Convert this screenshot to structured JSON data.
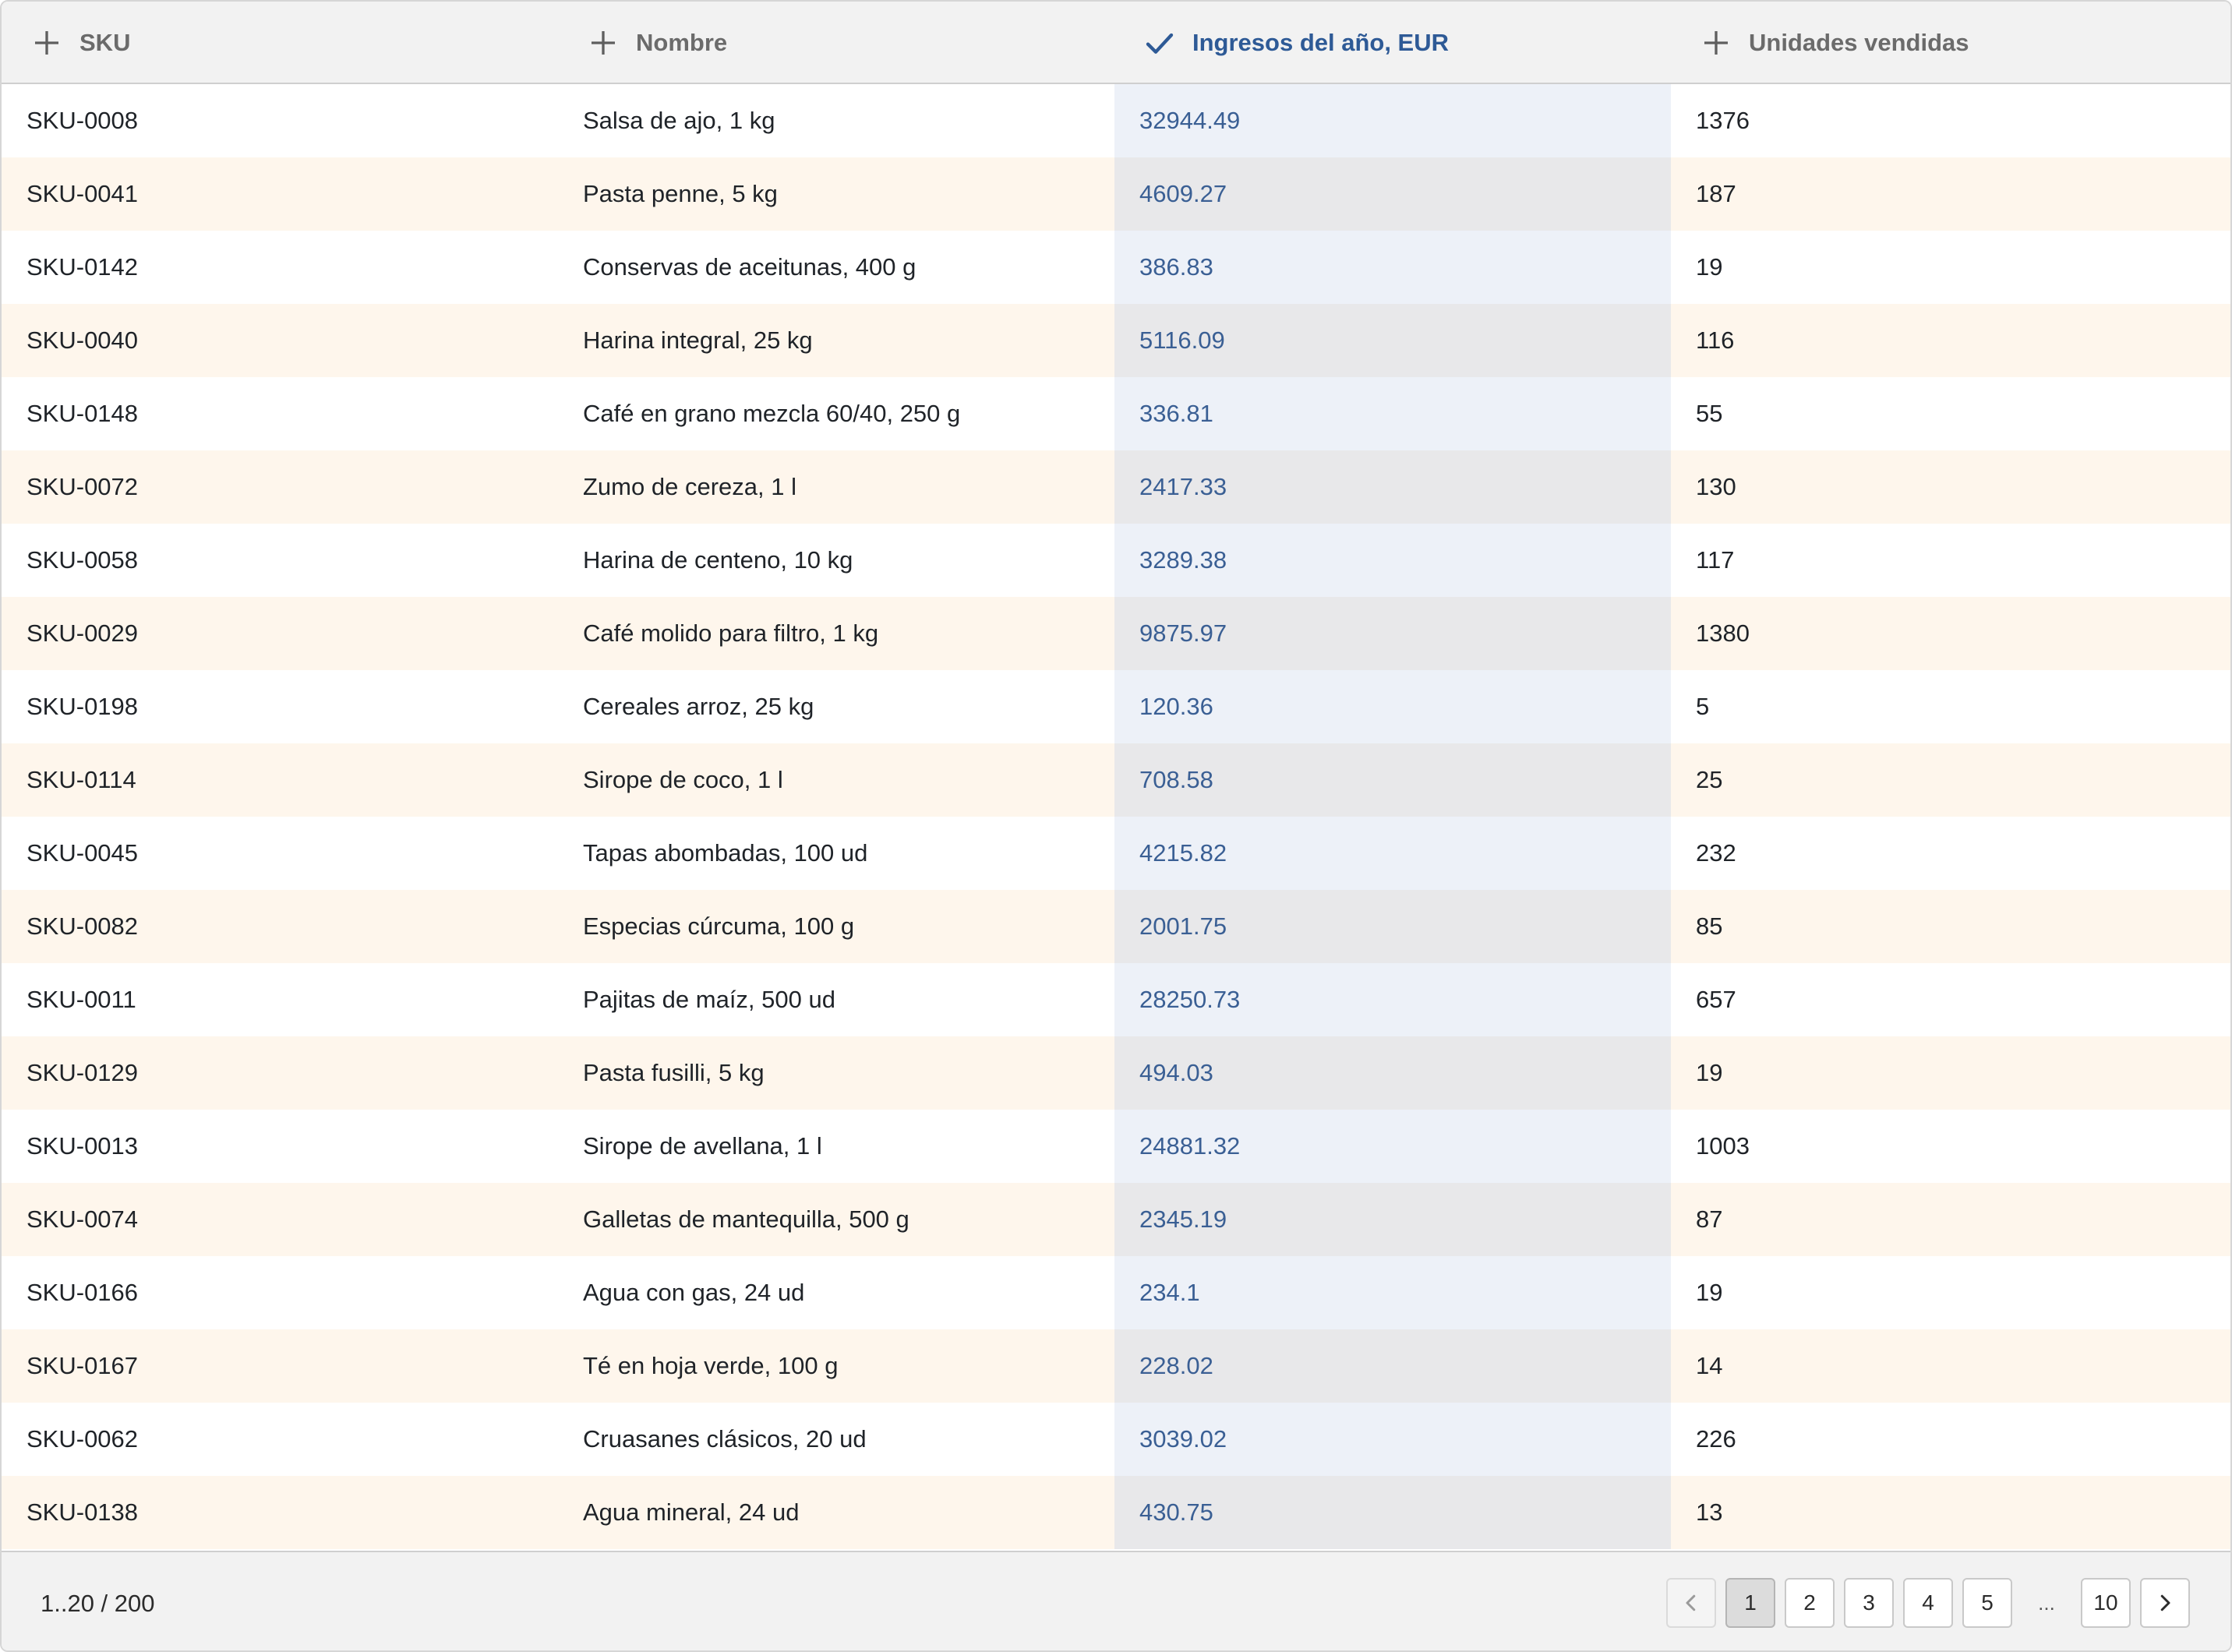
{
  "columns": [
    {
      "label": "SKU",
      "icon": "plus-icon"
    },
    {
      "label": "Nombre",
      "icon": "plus-icon"
    },
    {
      "label": "Ingresos del año, EUR",
      "icon": "check-icon",
      "sorted": true
    },
    {
      "label": "Unidades vendidas",
      "icon": "plus-icon"
    }
  ],
  "rows": [
    [
      "SKU-0008",
      "Salsa de ajo, 1 kg",
      "32944.49",
      "1376"
    ],
    [
      "SKU-0041",
      "Pasta penne, 5 kg",
      "4609.27",
      "187"
    ],
    [
      "SKU-0142",
      "Conservas de aceitunas, 400 g",
      "386.83",
      "19"
    ],
    [
      "SKU-0040",
      "Harina integral, 25 kg",
      "5116.09",
      "116"
    ],
    [
      "SKU-0148",
      "Café en grano mezcla 60/40, 250 g",
      "336.81",
      "55"
    ],
    [
      "SKU-0072",
      "Zumo de cereza, 1 l",
      "2417.33",
      "130"
    ],
    [
      "SKU-0058",
      "Harina de centeno, 10 kg",
      "3289.38",
      "117"
    ],
    [
      "SKU-0029",
      "Café molido para filtro, 1 kg",
      "9875.97",
      "1380"
    ],
    [
      "SKU-0198",
      "Cereales arroz, 25 kg",
      "120.36",
      "5"
    ],
    [
      "SKU-0114",
      "Sirope de coco, 1 l",
      "708.58",
      "25"
    ],
    [
      "SKU-0045",
      "Tapas abombadas, 100 ud",
      "4215.82",
      "232"
    ],
    [
      "SKU-0082",
      "Especias cúrcuma, 100 g",
      "2001.75",
      "85"
    ],
    [
      "SKU-0011",
      "Pajitas de maíz, 500 ud",
      "28250.73",
      "657"
    ],
    [
      "SKU-0129",
      "Pasta fusilli, 5 kg",
      "494.03",
      "19"
    ],
    [
      "SKU-0013",
      "Sirope de avellana, 1 l",
      "24881.32",
      "1003"
    ],
    [
      "SKU-0074",
      "Galletas de mantequilla, 500 g",
      "2345.19",
      "87"
    ],
    [
      "SKU-0166",
      "Agua con gas, 24 ud",
      "234.1",
      "19"
    ],
    [
      "SKU-0167",
      "Té en hoja verde, 100 g",
      "228.02",
      "14"
    ],
    [
      "SKU-0062",
      "Cruasanes clásicos, 20 ud",
      "3039.02",
      "226"
    ],
    [
      "SKU-0138",
      "Agua mineral, 24 ud",
      "430.75",
      "13"
    ]
  ],
  "footer": {
    "range": "1..20 / 200",
    "pages": [
      "1",
      "2",
      "3",
      "4",
      "5"
    ],
    "ellipsis": "...",
    "last_page": "10",
    "current_page": "1",
    "prev_icon": "chevron-left-icon",
    "next_icon": "chevron-right-icon"
  },
  "colors": {
    "sorted_text": "#2e5a96",
    "row_alt": "#fef6ec",
    "sorted_col": "#edf1f8"
  }
}
